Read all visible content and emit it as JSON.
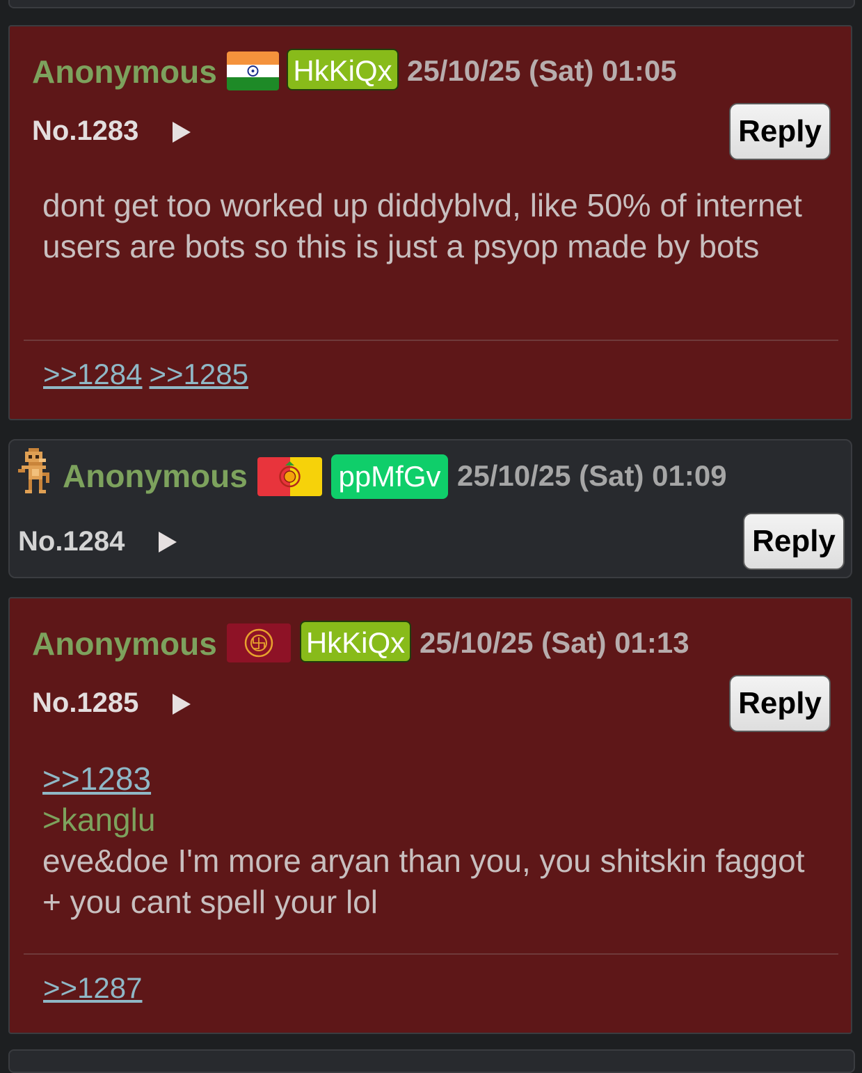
{
  "posts": [
    {
      "name": "Anonymous",
      "flag": "india-flag",
      "poster_id": "HkKiQx",
      "poster_id_color": "#88bb1a",
      "datetime": "25/10/25 (Sat) 01:05",
      "number": "No.1283",
      "reply_label": "Reply",
      "body": "dont get too worked up diddyblvd, like 50% of internet users are bots so this is just a psyop made by bots",
      "backlinks": [
        ">>1284",
        ">>1285"
      ]
    },
    {
      "name": "Anonymous",
      "avatar": "pixel-monkey-icon",
      "flag": "red-yellow-emblem-flag",
      "poster_id": "ppMfGv",
      "poster_id_color": "#0fce6a",
      "datetime": "25/10/25 (Sat) 01:09",
      "number": "No.1284",
      "reply_label": "Reply"
    },
    {
      "name": "Anonymous",
      "flag": "maroon-emblem-flag",
      "poster_id": "HkKiQx",
      "poster_id_color": "#88bb1a",
      "datetime": "25/10/25 (Sat) 01:13",
      "number": "No.1285",
      "reply_label": "Reply",
      "quote": ">>1283",
      "greentext": ">kanglu",
      "body": "eve&doe I'm more aryan than you, you shitskin faggot + you cant spell your lol",
      "backlinks": [
        ">>1287"
      ]
    }
  ]
}
